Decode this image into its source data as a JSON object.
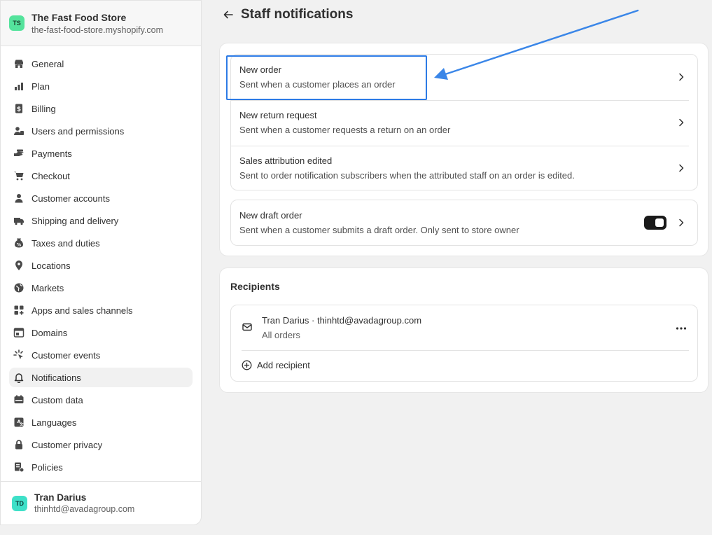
{
  "store": {
    "initials": "TS",
    "name": "The Fast Food Store",
    "url": "the-fast-food-store.myshopify.com"
  },
  "nav": [
    {
      "label": "General",
      "icon": "store-icon"
    },
    {
      "label": "Plan",
      "icon": "plan-icon"
    },
    {
      "label": "Billing",
      "icon": "billing-icon"
    },
    {
      "label": "Users and permissions",
      "icon": "users-icon"
    },
    {
      "label": "Payments",
      "icon": "payments-icon"
    },
    {
      "label": "Checkout",
      "icon": "cart-icon"
    },
    {
      "label": "Customer accounts",
      "icon": "person-icon"
    },
    {
      "label": "Shipping and delivery",
      "icon": "truck-icon"
    },
    {
      "label": "Taxes and duties",
      "icon": "tax-icon"
    },
    {
      "label": "Locations",
      "icon": "location-icon"
    },
    {
      "label": "Markets",
      "icon": "globe-icon"
    },
    {
      "label": "Apps and sales channels",
      "icon": "apps-icon"
    },
    {
      "label": "Domains",
      "icon": "domains-icon"
    },
    {
      "label": "Customer events",
      "icon": "events-icon"
    },
    {
      "label": "Notifications",
      "icon": "bell-icon",
      "active": true
    },
    {
      "label": "Custom data",
      "icon": "data-icon"
    },
    {
      "label": "Languages",
      "icon": "languages-icon"
    },
    {
      "label": "Customer privacy",
      "icon": "lock-icon"
    },
    {
      "label": "Policies",
      "icon": "policies-icon"
    }
  ],
  "user": {
    "initials": "TD",
    "name": "Tran Darius",
    "email": "thinhtd@avadagroup.com"
  },
  "page": {
    "title": "Staff notifications"
  },
  "notifications": [
    {
      "title": "New order",
      "description": "Sent when a customer places an order"
    },
    {
      "title": "New return request",
      "description": "Sent when a customer requests a return on an order"
    },
    {
      "title": "Sales attribution edited",
      "description": "Sent to order notification subscribers when the attributed staff on an order is edited."
    }
  ],
  "draft": {
    "title": "New draft order",
    "description": "Sent when a customer submits a draft order. Only sent to store owner",
    "toggle_on": true
  },
  "recipients": {
    "title": "Recipients",
    "items": [
      {
        "name": "Tran Darius · thinhtd@avadagroup.com",
        "scope": "All orders"
      }
    ],
    "add_label": "Add recipient"
  },
  "colors": {
    "accent": "#2d7be5",
    "store_avatar": "#54e39c",
    "user_avatar": "#3ee0c8"
  }
}
